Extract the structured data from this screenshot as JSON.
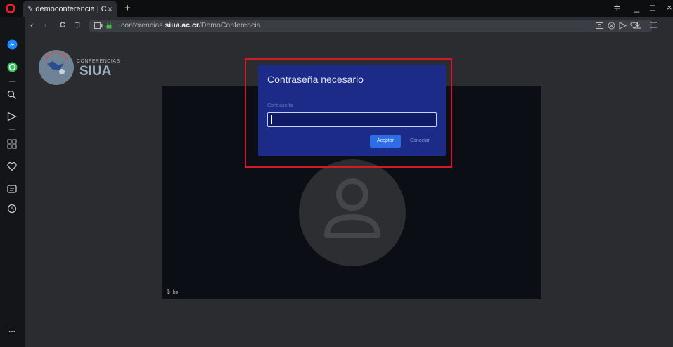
{
  "tab": {
    "title": "democonferencia | C",
    "close": "×",
    "new": "+"
  },
  "window_controls": {
    "minimize": "_",
    "maximize": "□",
    "close": "×",
    "menu": "≑"
  },
  "address": {
    "prefix": "conferencias.",
    "domain": "siua.ac.cr",
    "path": "/DemoConferencia"
  },
  "nav": {
    "back": "‹",
    "forward": "›",
    "reload": "C",
    "speed_dial": "⊞"
  },
  "brand": {
    "line1": "CONFERENCIAS",
    "line2": "SIUA"
  },
  "video": {
    "participant": "ko"
  },
  "dialog": {
    "title": "Contraseña necesario",
    "label": "Contraseña",
    "input_value": "",
    "accept": "Aceptar",
    "cancel": "Cancelar"
  },
  "sidebar_more": "...",
  "colors": {
    "dialog": "#1c2a88",
    "accent": "#2e6de6",
    "highlight": "#d11a26",
    "opera": "#e5202f"
  }
}
